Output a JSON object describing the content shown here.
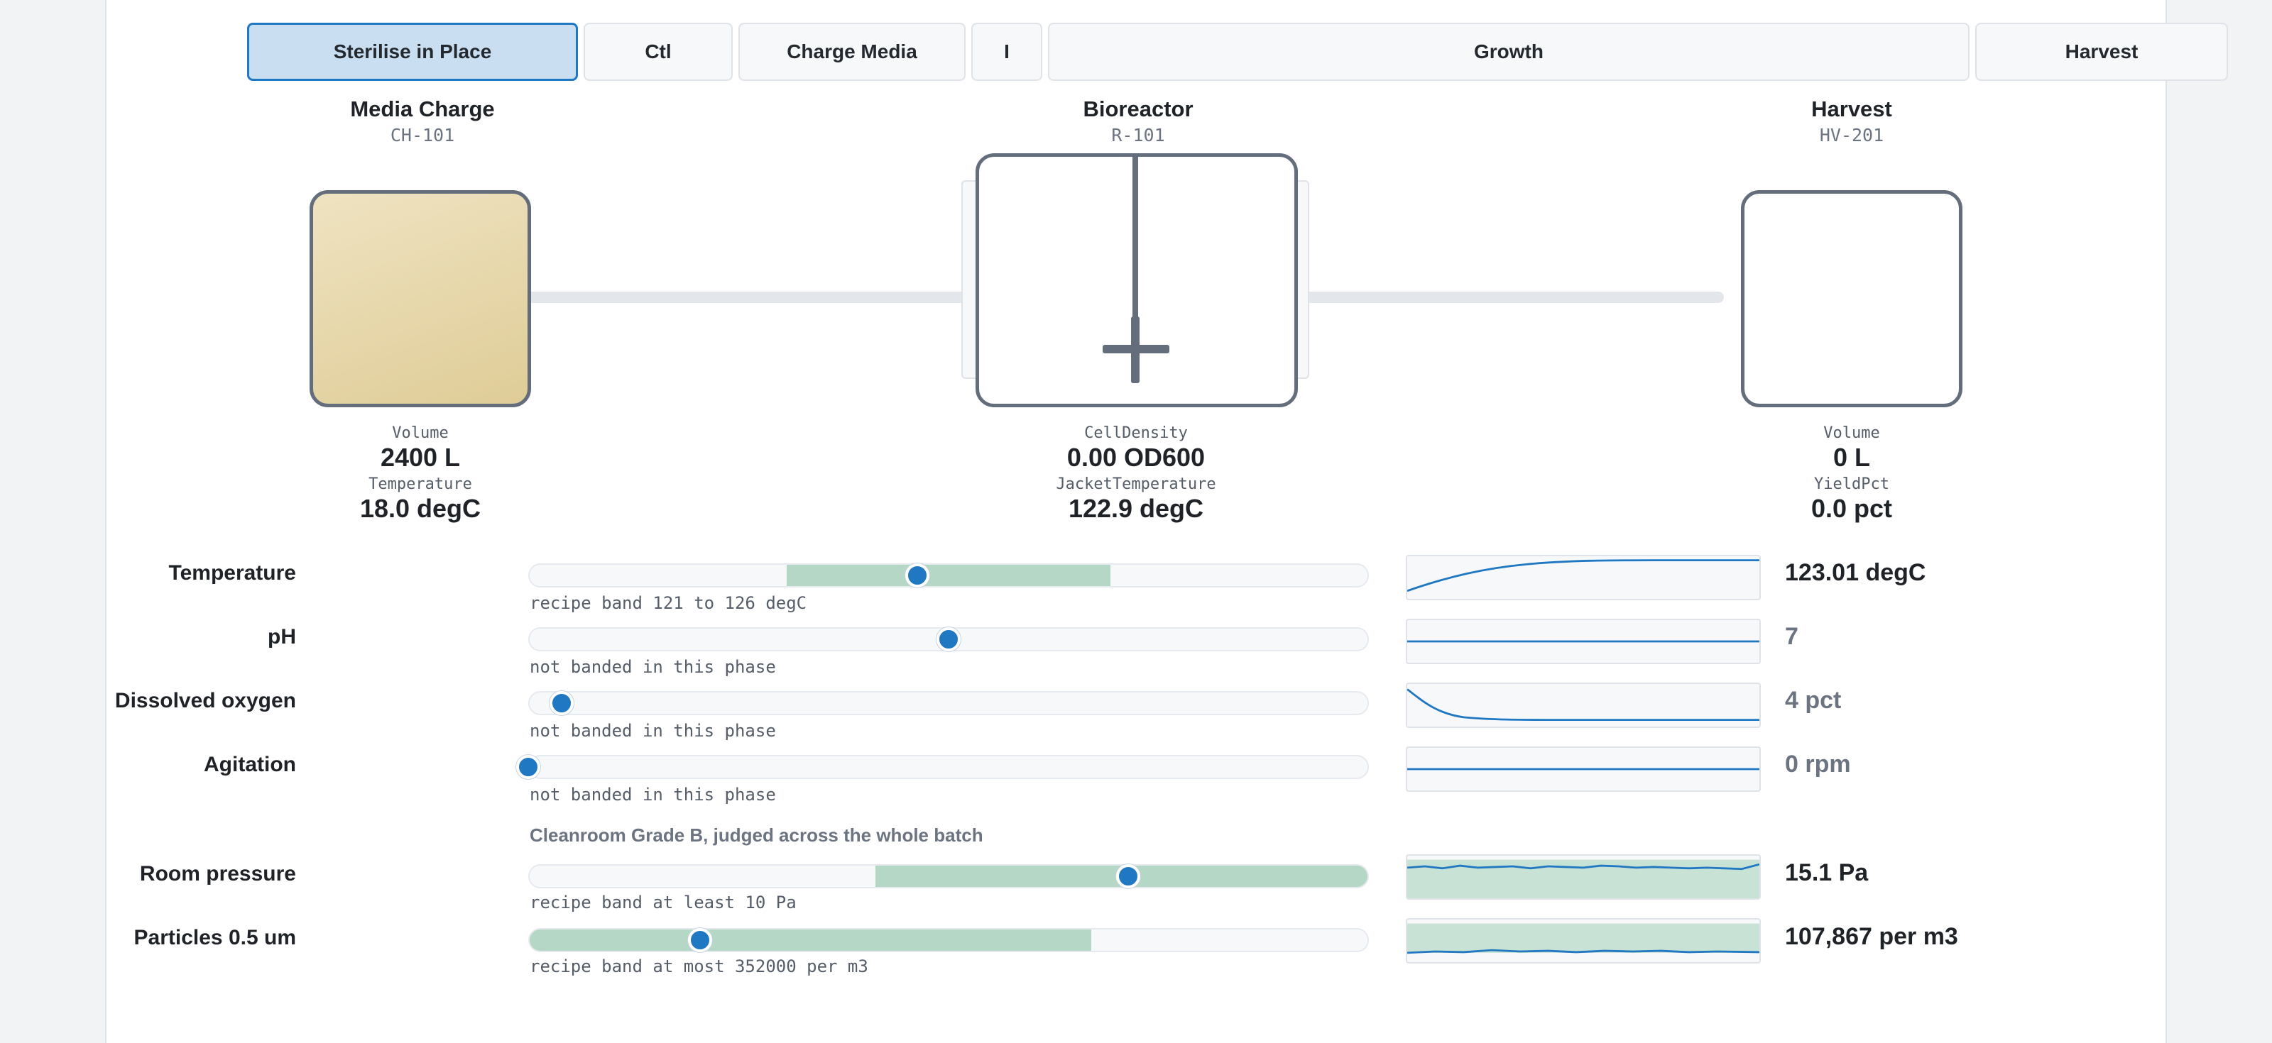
{
  "phases": [
    {
      "label": "Sterilise in Place",
      "active": true
    },
    {
      "label": "Ctl",
      "active": false
    },
    {
      "label": "Charge Media",
      "active": false
    },
    {
      "label": "I",
      "active": false
    },
    {
      "label": "Growth",
      "active": false
    },
    {
      "label": "Harvest",
      "active": false
    }
  ],
  "units": {
    "media": {
      "title": "Media Charge",
      "tag": "CH-101",
      "readouts": [
        {
          "label": "Volume",
          "value": "2400 L"
        },
        {
          "label": "Temperature",
          "value": "18.0 degC"
        }
      ]
    },
    "reactor": {
      "title": "Bioreactor",
      "tag": "R-101",
      "readouts": [
        {
          "label": "CellDensity",
          "value": "0.00 OD600"
        },
        {
          "label": "JacketTemperature",
          "value": "122.9 degC"
        }
      ]
    },
    "harvest": {
      "title": "Harvest",
      "tag": "HV-201",
      "readouts": [
        {
          "label": "Volume",
          "value": "0 L"
        },
        {
          "label": "YieldPct",
          "value": "0.0 pct"
        }
      ]
    }
  },
  "parameters": [
    {
      "label": "Temperature",
      "note": "recipe band 121 to 126 degC",
      "value": "123.01 degC",
      "live": true,
      "band": [
        0.307,
        0.693
      ],
      "position": 0.463
    },
    {
      "label": "pH",
      "note": "not banded in this phase",
      "value": "7",
      "live": false,
      "band": null,
      "position": 0.5
    },
    {
      "label": "Dissolved oxygen",
      "note": "not banded in this phase",
      "value": "4 pct",
      "live": false,
      "band": null,
      "position": 0.04
    },
    {
      "label": "Agitation",
      "note": "not banded in this phase",
      "value": "0 rpm",
      "live": false,
      "band": null,
      "position": 0.0
    }
  ],
  "environment": {
    "heading": "Cleanroom Grade B, judged across the whole batch",
    "parameters": [
      {
        "label": "Room pressure",
        "note": "recipe band at least 10 Pa",
        "value": "15.1 Pa",
        "live": true,
        "band": [
          0.413,
          1.0
        ],
        "position": 0.714
      },
      {
        "label": "Particles 0.5 um",
        "note": "recipe band at most 352000 per m3",
        "value": "107,867 per m3",
        "live": true,
        "band": [
          0.0,
          0.67
        ],
        "position": 0.204
      }
    ]
  },
  "colors": {
    "accent": "#1f78c1",
    "band": "#b5d8c6",
    "vessel_outline": "#636d7c",
    "media_fill": "#e6d7aa"
  }
}
